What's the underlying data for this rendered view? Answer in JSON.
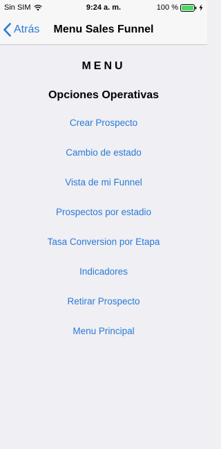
{
  "status_bar": {
    "carrier": "Sin SIM",
    "time": "9:24 a. m.",
    "battery_percent": "100 %",
    "wifi_icon": "wifi-icon",
    "battery_icon": "battery-full-icon",
    "charging_icon": "bolt-icon",
    "battery_color": "#4cd964"
  },
  "nav": {
    "back_label": "Atrás",
    "back_icon": "chevron-left-icon",
    "title": "Menu Sales Funnel",
    "accent_color": "#2a7ad6"
  },
  "main": {
    "menu_heading": "MENU",
    "section_heading": "Opciones Operativas",
    "items": [
      {
        "label": "Crear Prospecto"
      },
      {
        "label": "Cambio de estado"
      },
      {
        "label": "Vista de mi Funnel"
      },
      {
        "label": "Prospectos por estadio"
      },
      {
        "label": "Tasa Conversion por Etapa"
      },
      {
        "label": "Indicadores"
      },
      {
        "label": "Retirar Prospecto"
      },
      {
        "label": "Menu Principal"
      }
    ]
  }
}
